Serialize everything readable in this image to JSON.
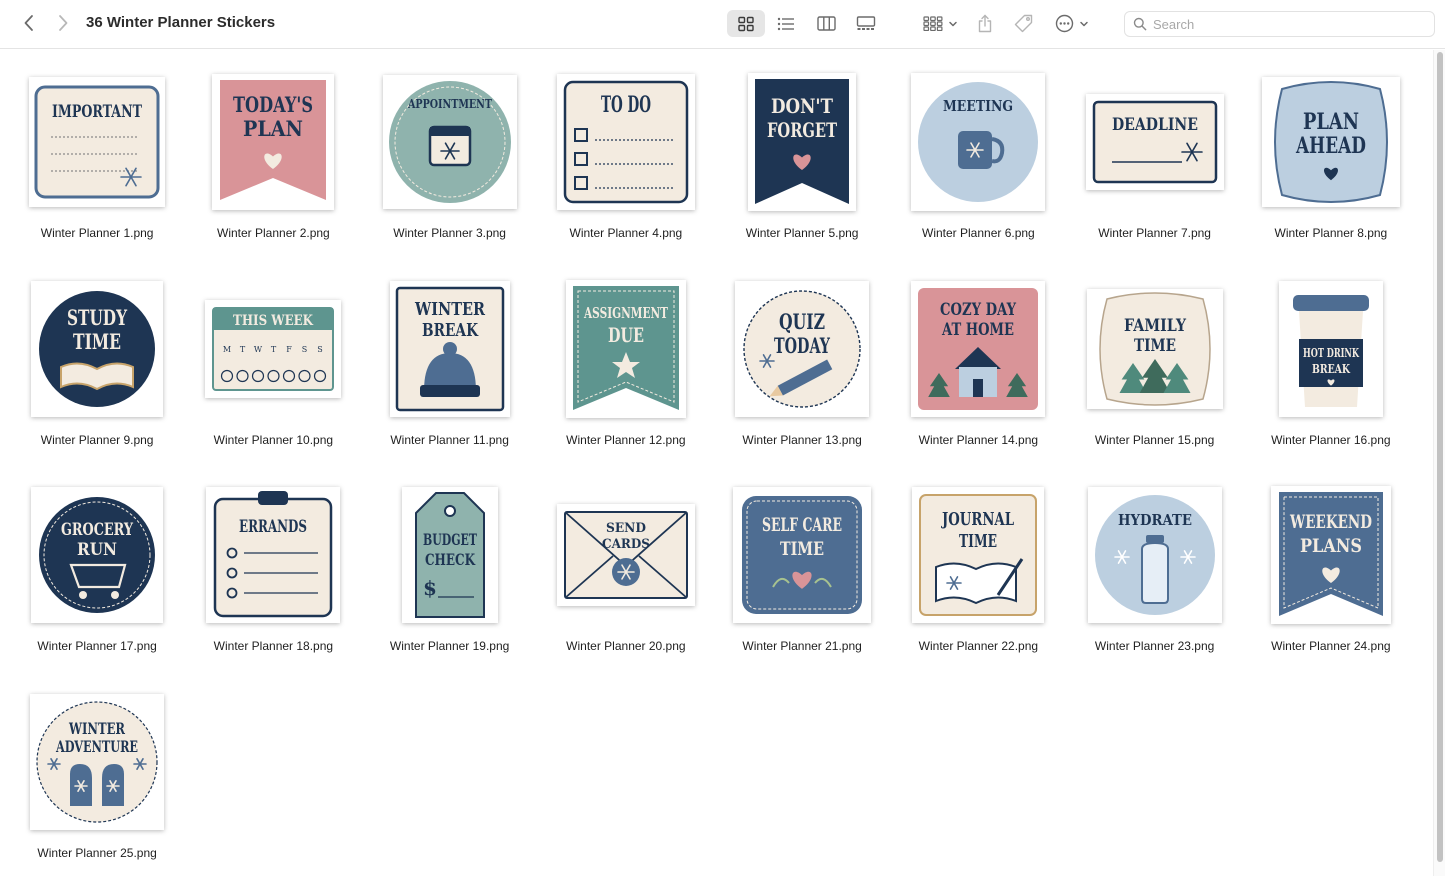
{
  "window": {
    "title": "36 Winter Planner Stickers"
  },
  "toolbar": {
    "back_icon": "chevron-left-icon",
    "forward_icon": "chevron-right-icon",
    "views": [
      "icon-view-icon",
      "list-view-icon",
      "column-view-icon",
      "gallery-view-icon"
    ],
    "active_view": "icon",
    "group_icon": "group-icon",
    "share_icon": "share-icon",
    "tag_icon": "tag-icon",
    "more_icon": "ellipsis-circle-icon"
  },
  "search": {
    "placeholder": "Search"
  },
  "colors": {
    "navy": "#1e3553",
    "teal": "#5e958f",
    "pink": "#d99498",
    "cream": "#f3ebe0",
    "slate_blue": "#4e6d92",
    "light_blue": "#bccfe0",
    "sage": "#8fb3ad"
  },
  "files": [
    {
      "name": "Winter Planner 1.png",
      "sticker": {
        "text": [
          "IMPORTANT"
        ]
      }
    },
    {
      "name": "Winter Planner 2.png",
      "sticker": {
        "text": [
          "TODAY'S",
          "PLAN"
        ]
      }
    },
    {
      "name": "Winter Planner 3.png",
      "sticker": {
        "text": [
          "APPOINTMENT"
        ]
      }
    },
    {
      "name": "Winter Planner 4.png",
      "sticker": {
        "text": [
          "TO DO"
        ]
      }
    },
    {
      "name": "Winter Planner 5.png",
      "sticker": {
        "text": [
          "DON'T",
          "FORGET"
        ]
      }
    },
    {
      "name": "Winter Planner 6.png",
      "sticker": {
        "text": [
          "MEETING"
        ]
      }
    },
    {
      "name": "Winter Planner 7.png",
      "sticker": {
        "text": [
          "DEADLINE"
        ]
      }
    },
    {
      "name": "Winter Planner 8.png",
      "sticker": {
        "text": [
          "PLAN",
          "AHEAD"
        ]
      }
    },
    {
      "name": "Winter Planner 9.png",
      "sticker": {
        "text": [
          "STUDY",
          "TIME"
        ]
      }
    },
    {
      "name": "Winter Planner 10.png",
      "sticker": {
        "text": [
          "THIS WEEK"
        ],
        "days": [
          "M",
          "T",
          "W",
          "T",
          "F",
          "S",
          "S"
        ]
      }
    },
    {
      "name": "Winter Planner 11.png",
      "sticker": {
        "text": [
          "WINTER",
          "BREAK"
        ]
      }
    },
    {
      "name": "Winter Planner 12.png",
      "sticker": {
        "text": [
          "ASSIGNMENT",
          "DUE"
        ]
      }
    },
    {
      "name": "Winter Planner 13.png",
      "sticker": {
        "text": [
          "QUIZ",
          "TODAY"
        ]
      }
    },
    {
      "name": "Winter Planner 14.png",
      "sticker": {
        "text": [
          "COZY DAY",
          "AT HOME"
        ]
      }
    },
    {
      "name": "Winter Planner 15.png",
      "sticker": {
        "text": [
          "FAMILY",
          "TIME"
        ]
      }
    },
    {
      "name": "Winter Planner 16.png",
      "sticker": {
        "text": [
          "HOT DRINK",
          "BREAK"
        ]
      }
    },
    {
      "name": "Winter Planner 17.png",
      "sticker": {
        "text": [
          "GROCERY",
          "RUN"
        ]
      }
    },
    {
      "name": "Winter Planner 18.png",
      "sticker": {
        "text": [
          "ERRANDS"
        ]
      }
    },
    {
      "name": "Winter Planner 19.png",
      "sticker": {
        "text": [
          "BUDGET",
          "CHECK",
          "$"
        ]
      }
    },
    {
      "name": "Winter Planner 20.png",
      "sticker": {
        "text": [
          "SEND",
          "CARDS"
        ]
      }
    },
    {
      "name": "Winter Planner 21.png",
      "sticker": {
        "text": [
          "SELF CARE",
          "TIME"
        ]
      }
    },
    {
      "name": "Winter Planner 22.png",
      "sticker": {
        "text": [
          "JOURNAL",
          "TIME"
        ]
      }
    },
    {
      "name": "Winter Planner 23.png",
      "sticker": {
        "text": [
          "HYDRATE"
        ]
      }
    },
    {
      "name": "Winter Planner 24.png",
      "sticker": {
        "text": [
          "WEEKEND",
          "PLANS"
        ]
      }
    },
    {
      "name": "Winter Planner 25.png",
      "sticker": {
        "text": [
          "WINTER",
          "ADVENTURE"
        ]
      }
    }
  ]
}
